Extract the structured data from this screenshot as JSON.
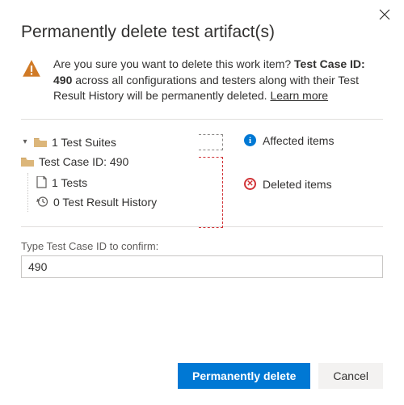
{
  "dialog": {
    "title": "Permanently delete test artifact(s)",
    "close_aria": "Close"
  },
  "warning": {
    "prefix": "Are you sure you want to delete this work item? ",
    "bold_id": "Test Case ID: 490",
    "suffix": " across all configurations and testers along with their Test Result History will be permanently deleted. ",
    "learn_more": "Learn more"
  },
  "tree": {
    "suites_label": "1 Test Suites",
    "case_label": "Test Case ID: 490",
    "tests_label": "1 Tests",
    "history_label": "0 Test Result History"
  },
  "legend": {
    "affected": "Affected items",
    "deleted": "Deleted items"
  },
  "confirm": {
    "label": "Type Test Case ID to confirm:",
    "value": "490"
  },
  "buttons": {
    "primary": "Permanently delete",
    "secondary": "Cancel"
  }
}
